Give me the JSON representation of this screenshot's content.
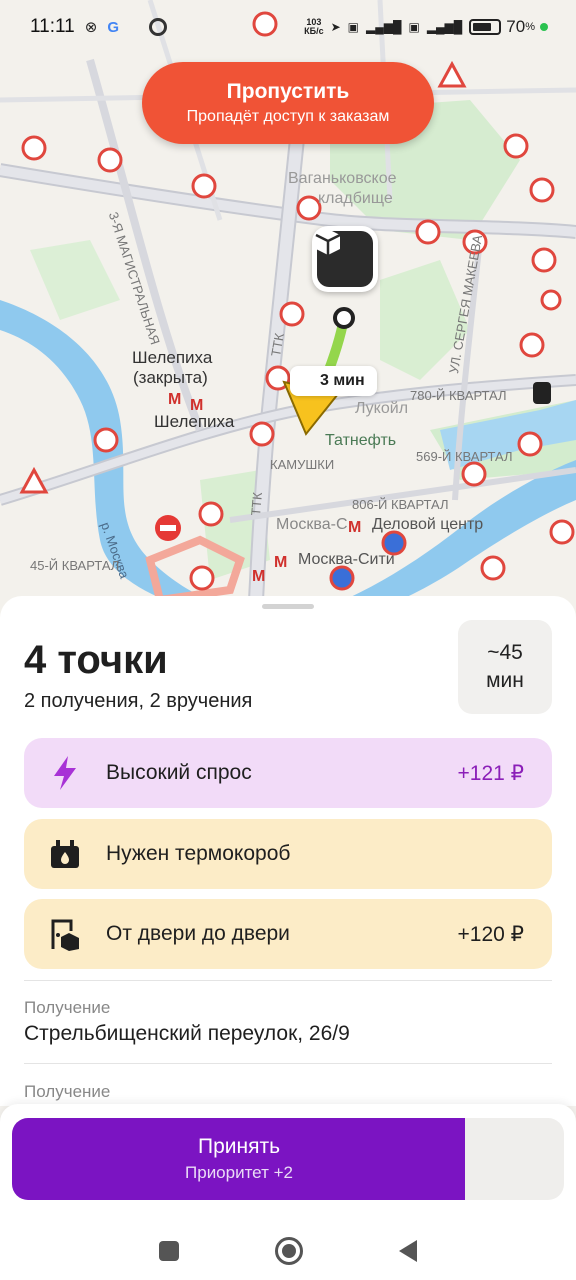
{
  "status_bar": {
    "time": "11:11",
    "speed_value": "103",
    "speed_unit": "КБ/с",
    "battery": "70",
    "battery_unit": "%"
  },
  "map": {
    "skip_button": {
      "title": "Пропустить",
      "subtitle": "Пропадёт доступ к заказам"
    },
    "eta_chip": "3 мин",
    "labels": {
      "shelepikha_closed": "Шелепиха",
      "shelepikha_closed_2": "(закрыта)",
      "shelepikha": "Шелепиха",
      "vagankovskoe": "Ваганьковское",
      "vagankovskoe_2": "кладбище",
      "kamushki": "КАМУШКИ",
      "tatneft": "Татнефть",
      "q780": "780-Й КВАРТАЛ",
      "q569": "569-Й КВАРТАЛ",
      "q806": "806-Й КВАРТАЛ",
      "delovoy": "Деловой центр",
      "moskva_city": "Москва-Сити",
      "moskva_c": "Москва-С",
      "river": "р. Москва",
      "q45": "45-Й КВАРТАЛ",
      "ttk": "ТТК",
      "ttk2": "ТТК",
      "makeeva": "УЛ. СЕРГЕЯ МАКЕЕВА",
      "magistral": "3-Я МАГИСТРАЛЬНАЯ",
      "lukoil": "Лукойл"
    }
  },
  "order": {
    "title": "4 точки",
    "subtitle": "2 получения, 2 вручения",
    "duration_value": "~45",
    "duration_unit": "мин",
    "badges": {
      "demand": {
        "label": "Высокий спрос",
        "value": "+121 ₽",
        "icon": "lightning-icon",
        "color": "#f2dbf8"
      },
      "thermo": {
        "label": "Нужен термокороб",
        "icon": "thermobox-icon",
        "color": "#fcecc7"
      },
      "door": {
        "label": "От двери до двери",
        "value": "+120 ₽",
        "icon": "door-box-icon",
        "color": "#fcecc7"
      }
    },
    "stops": [
      {
        "caption": "Получение",
        "address": "Стрельбищенский переулок, 26/9"
      },
      {
        "caption": "Получение",
        "address": ""
      }
    ]
  },
  "accept_button": {
    "title": "Принять",
    "subtitle": "Приоритет +2",
    "progress": 0.82,
    "color": "#7b14c2"
  },
  "colors": {
    "skip": "#f05336",
    "accent": "#7b14c2"
  }
}
